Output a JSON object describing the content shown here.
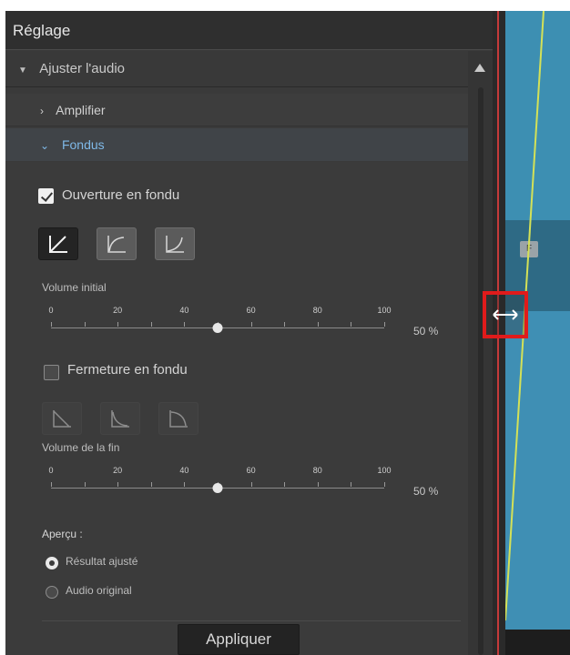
{
  "panel": {
    "title": "Réglage",
    "section": "Ajuster l'audio",
    "sub_amplifier": "Amplifier",
    "sub_fondus": "Fondus"
  },
  "fade_in": {
    "label": "Ouverture en fondu",
    "checked": true,
    "volume_label": "Volume initial",
    "value": 50,
    "value_text": "50 %"
  },
  "fade_out": {
    "label": "Fermeture en fondu",
    "checked": false,
    "volume_label": "Volume de la fin",
    "value": 50,
    "value_text": "50 %"
  },
  "slider_ticks": [
    "0",
    "20",
    "40",
    "60",
    "80",
    "100"
  ],
  "preview": {
    "label": "Aperçu :",
    "options": [
      "Résultat ajusté",
      "Audio original"
    ],
    "selected": 0
  },
  "apply_label": "Appliquer",
  "timeline": {
    "marker_text": "F"
  },
  "colors": {
    "accent": "#7fb9e8",
    "highlight": "#e01b1b",
    "waveform": "#3d8fb2",
    "fade_line": "#d4e157"
  },
  "icons": [
    "chevron-down-icon",
    "chevron-right-icon",
    "fade-curve-linear-icon",
    "fade-curve-log-icon",
    "fade-curve-exp-icon",
    "horizontal-resize-icon",
    "scroll-up-icon"
  ]
}
